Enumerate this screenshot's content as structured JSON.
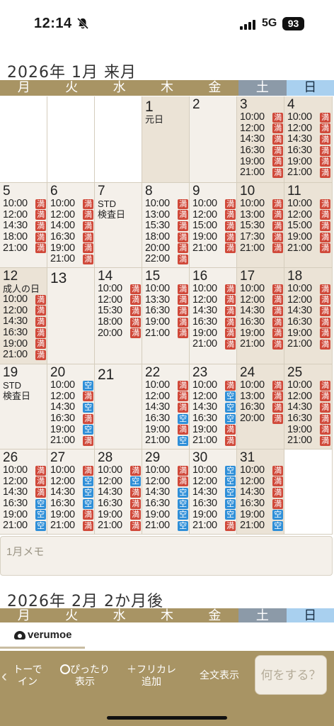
{
  "status": {
    "time": "12:14",
    "network": "5G",
    "battery": "93"
  },
  "weekdays": [
    {
      "label": "月",
      "kind": "wd"
    },
    {
      "label": "火",
      "kind": "wd"
    },
    {
      "label": "水",
      "kind": "wd"
    },
    {
      "label": "木",
      "kind": "wd"
    },
    {
      "label": "金",
      "kind": "wd"
    },
    {
      "label": "土",
      "kind": "sat"
    },
    {
      "label": "日",
      "kind": "sun"
    }
  ],
  "month1": {
    "title": "2026年 1月 来月",
    "weeks": [
      [
        {
          "empty": true
        },
        {
          "empty": true
        },
        {
          "empty": true
        },
        {
          "day": "1",
          "note": "元日",
          "type": "holiday",
          "slots": []
        },
        {
          "day": "2",
          "slots": []
        },
        {
          "day": "3",
          "type": "weekend",
          "slots": [
            [
              "10:00",
              "満"
            ],
            [
              "12:00",
              "満"
            ],
            [
              "14:30",
              "満"
            ],
            [
              "16:30",
              "満"
            ],
            [
              "19:00",
              "満"
            ],
            [
              "21:00",
              "満"
            ]
          ]
        },
        {
          "day": "4",
          "type": "weekend",
          "slots": [
            [
              "10:00",
              "満"
            ],
            [
              "12:00",
              "満"
            ],
            [
              "14:30",
              "満"
            ],
            [
              "16:30",
              "満"
            ],
            [
              "19:00",
              "満"
            ],
            [
              "21:00",
              "満"
            ]
          ]
        }
      ],
      [
        {
          "day": "5",
          "slots": [
            [
              "10:00",
              "満"
            ],
            [
              "12:00",
              "満"
            ],
            [
              "14:30",
              "満"
            ],
            [
              "18:00",
              "満"
            ],
            [
              "21:00",
              "満"
            ]
          ]
        },
        {
          "day": "6",
          "slots": [
            [
              "10:00",
              "満"
            ],
            [
              "12:00",
              "満"
            ],
            [
              "14:00",
              "満"
            ],
            [
              "16:30",
              "満"
            ],
            [
              "19:00",
              "満"
            ],
            [
              "21:00",
              "満"
            ]
          ]
        },
        {
          "day": "7",
          "note": "STD",
          "note2": "検査日",
          "slots": []
        },
        {
          "day": "8",
          "slots": [
            [
              "10:00",
              "満"
            ],
            [
              "13:00",
              "満"
            ],
            [
              "15:30",
              "満"
            ],
            [
              "18:00",
              "満"
            ],
            [
              "20:00",
              "満"
            ],
            [
              "22:00",
              "満"
            ]
          ]
        },
        {
          "day": "9",
          "slots": [
            [
              "10:00",
              "満"
            ],
            [
              "12:00",
              "満"
            ],
            [
              "15:00",
              "満"
            ],
            [
              "19:00",
              "満"
            ],
            [
              "21:00",
              "満"
            ]
          ]
        },
        {
          "day": "10",
          "type": "weekend",
          "slots": [
            [
              "10:00",
              "満"
            ],
            [
              "13:00",
              "満"
            ],
            [
              "15:30",
              "満"
            ],
            [
              "17:30",
              "満"
            ],
            [
              "21:00",
              "満"
            ]
          ]
        },
        {
          "day": "11",
          "type": "weekend",
          "slots": [
            [
              "10:00",
              "満"
            ],
            [
              "12:00",
              "満"
            ],
            [
              "15:00",
              "満"
            ],
            [
              "19:00",
              "満"
            ],
            [
              "21:00",
              "満"
            ]
          ]
        }
      ],
      [
        {
          "day": "12",
          "note": "成人の日",
          "type": "holiday",
          "slots": [
            [
              "10:00",
              "満"
            ],
            [
              "12:00",
              "満"
            ],
            [
              "14:30",
              "満"
            ],
            [
              "16:30",
              "満"
            ],
            [
              "19:00",
              "満"
            ],
            [
              "21:00",
              "満"
            ]
          ]
        },
        {
          "day": "13",
          "slots": []
        },
        {
          "day": "14",
          "slots": [
            [
              "10:00",
              "満"
            ],
            [
              "12:00",
              "満"
            ],
            [
              "15:30",
              "満"
            ],
            [
              "18:00",
              "満"
            ],
            [
              "20:00",
              "満"
            ]
          ]
        },
        {
          "day": "15",
          "slots": [
            [
              "10:00",
              "満"
            ],
            [
              "13:30",
              "満"
            ],
            [
              "16:30",
              "満"
            ],
            [
              "19:00",
              "満"
            ],
            [
              "21:00",
              "満"
            ]
          ]
        },
        {
          "day": "16",
          "slots": [
            [
              "10:00",
              "満"
            ],
            [
              "12:00",
              "満"
            ],
            [
              "14:30",
              "満"
            ],
            [
              "16:30",
              "満"
            ],
            [
              "19:00",
              "満"
            ],
            [
              "21:00",
              "満"
            ]
          ]
        },
        {
          "day": "17",
          "type": "weekend",
          "slots": [
            [
              "10:00",
              "満"
            ],
            [
              "12:00",
              "満"
            ],
            [
              "14:30",
              "満"
            ],
            [
              "16:30",
              "満"
            ],
            [
              "19:00",
              "満"
            ],
            [
              "21:00",
              "満"
            ]
          ]
        },
        {
          "day": "18",
          "type": "weekend",
          "slots": [
            [
              "10:00",
              "満"
            ],
            [
              "12:00",
              "満"
            ],
            [
              "14:30",
              "満"
            ],
            [
              "16:30",
              "満"
            ],
            [
              "19:00",
              "満"
            ],
            [
              "21:00",
              "満"
            ]
          ]
        }
      ],
      [
        {
          "day": "19",
          "note": "STD",
          "note2": "検査日",
          "slots": []
        },
        {
          "day": "20",
          "slots": [
            [
              "10:00",
              "空"
            ],
            [
              "12:00",
              "満"
            ],
            [
              "14:30",
              "空"
            ],
            [
              "16:30",
              "満"
            ],
            [
              "19:00",
              "空"
            ],
            [
              "21:00",
              "満"
            ]
          ]
        },
        {
          "day": "21",
          "slots": []
        },
        {
          "day": "22",
          "slots": [
            [
              "10:00",
              "満"
            ],
            [
              "12:00",
              "満"
            ],
            [
              "14:30",
              "満"
            ],
            [
              "16:30",
              "空"
            ],
            [
              "19:00",
              "満"
            ],
            [
              "21:00",
              "空"
            ]
          ]
        },
        {
          "day": "23",
          "slots": [
            [
              "10:00",
              "満"
            ],
            [
              "12:00",
              "空"
            ],
            [
              "14:30",
              "空"
            ],
            [
              "16:30",
              "空"
            ],
            [
              "19:00",
              "満"
            ],
            [
              "21:00",
              "満"
            ]
          ]
        },
        {
          "day": "24",
          "type": "weekend",
          "slots": [
            [
              "10:00",
              "満"
            ],
            [
              "13:00",
              "満"
            ],
            [
              "16:30",
              "満"
            ],
            [
              "20:00",
              "満"
            ]
          ]
        },
        {
          "day": "25",
          "type": "weekend",
          "slots": [
            [
              "10:00",
              "満"
            ],
            [
              "12:00",
              "満"
            ],
            [
              "14:30",
              "満"
            ],
            [
              "16:30",
              "満"
            ],
            [
              "19:00",
              "満"
            ],
            [
              "21:00",
              "満"
            ]
          ]
        }
      ],
      [
        {
          "day": "26",
          "slots": [
            [
              "10:00",
              "満"
            ],
            [
              "12:00",
              "満"
            ],
            [
              "14:30",
              "満"
            ],
            [
              "16:30",
              "空"
            ],
            [
              "19:00",
              "空"
            ],
            [
              "21:00",
              "空"
            ]
          ]
        },
        {
          "day": "27",
          "slots": [
            [
              "10:00",
              "満"
            ],
            [
              "12:00",
              "空"
            ],
            [
              "14:30",
              "空"
            ],
            [
              "16:30",
              "空"
            ],
            [
              "19:00",
              "満"
            ],
            [
              "21:00",
              "満"
            ]
          ]
        },
        {
          "day": "28",
          "slots": [
            [
              "10:00",
              "満"
            ],
            [
              "12:00",
              "空"
            ],
            [
              "14:30",
              "満"
            ],
            [
              "16:30",
              "満"
            ],
            [
              "19:00",
              "満"
            ],
            [
              "21:00",
              "満"
            ]
          ]
        },
        {
          "day": "29",
          "slots": [
            [
              "10:00",
              "満"
            ],
            [
              "12:00",
              "満"
            ],
            [
              "14:30",
              "空"
            ],
            [
              "16:30",
              "空"
            ],
            [
              "19:00",
              "空"
            ],
            [
              "21:00",
              "空"
            ]
          ]
        },
        {
          "day": "30",
          "slots": [
            [
              "10:00",
              "空"
            ],
            [
              "12:00",
              "空"
            ],
            [
              "14:30",
              "空"
            ],
            [
              "16:30",
              "空"
            ],
            [
              "19:00",
              "空"
            ],
            [
              "21:00",
              "満"
            ]
          ]
        },
        {
          "day": "31",
          "type": "weekend",
          "slots": [
            [
              "10:00",
              "満"
            ],
            [
              "12:00",
              "満"
            ],
            [
              "14:30",
              "満"
            ],
            [
              "16:30",
              "満"
            ],
            [
              "19:00",
              "空"
            ],
            [
              "21:00",
              "空"
            ]
          ]
        },
        {
          "empty": true
        }
      ]
    ],
    "memo_placeholder": "1月メモ"
  },
  "month2": {
    "title": "2026年 2月 2か月後"
  },
  "brand": "verumoe",
  "toolbar": {
    "back_line1": "トーで",
    "back_line2": "イン",
    "fit_line1": "ぴったり",
    "fit_line2": "表示",
    "furikana_line1": "＋フリカレ",
    "furikana_line2": "追加",
    "fulltext": "全文表示",
    "action_placeholder": "何をする？"
  }
}
